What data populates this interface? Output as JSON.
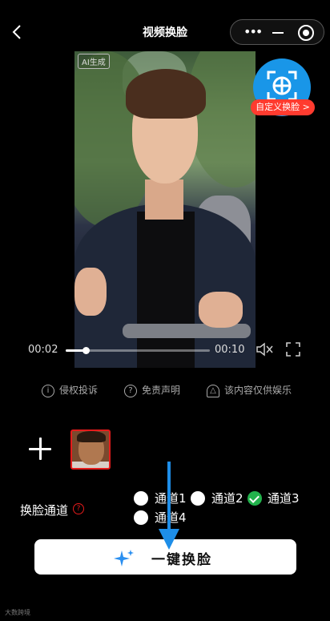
{
  "header": {
    "title": "视频换脸",
    "more_glyph": "•••"
  },
  "video": {
    "ai_badge": "AI生成",
    "current_time": "00:02",
    "total_time": "00:10",
    "progress": 0.14
  },
  "swap_badge": {
    "label": "自定义换脸 >",
    "color": "#1996e8",
    "label_color": "#ff3b2f"
  },
  "links": [
    {
      "icon": "info-icon",
      "label": "侵权投诉"
    },
    {
      "icon": "question-icon",
      "label": "免责声明"
    },
    {
      "icon": "bell-icon",
      "label": "该内容仅供娱乐"
    }
  ],
  "channel": {
    "label": "换脸通道",
    "help_glyph": "?",
    "options": [
      {
        "label": "通道1",
        "checked": false
      },
      {
        "label": "通道2",
        "checked": false
      },
      {
        "label": "通道3",
        "checked": true
      },
      {
        "label": "通道4",
        "checked": false
      }
    ]
  },
  "main_button": {
    "label": "一键换脸"
  },
  "watermark": "大数跨境",
  "colors": {
    "accent_blue": "#1996e8",
    "check_green": "#22b24c",
    "red": "#e51b1b"
  }
}
